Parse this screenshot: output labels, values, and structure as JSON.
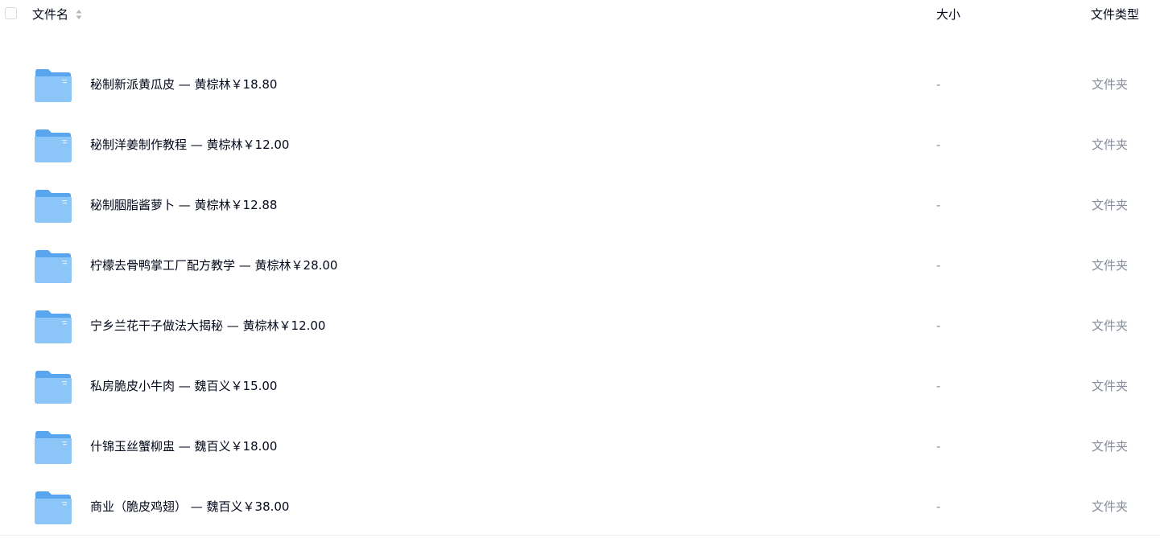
{
  "header": {
    "filename_label": "文件名",
    "size_label": "大小",
    "type_label": "文件类型"
  },
  "rows": [
    {
      "name": "秘制新派黄瓜皮 — 黄棕林￥18.80",
      "size": "-",
      "type": "文件夹"
    },
    {
      "name": "秘制洋姜制作教程 — 黄棕林￥12.00",
      "size": "-",
      "type": "文件夹"
    },
    {
      "name": "秘制胭脂酱萝卜 — 黄棕林￥12.88",
      "size": "-",
      "type": "文件夹"
    },
    {
      "name": "柠檬去骨鸭掌工厂配方教学 — 黄棕林￥28.00",
      "size": "-",
      "type": "文件夹"
    },
    {
      "name": "宁乡兰花干子做法大揭秘 — 黄棕林￥12.00",
      "size": "-",
      "type": "文件夹"
    },
    {
      "name": "私房脆皮小牛肉 — 魏百义￥15.00",
      "size": "-",
      "type": "文件夹"
    },
    {
      "name": "什锦玉丝蟹柳盅 — 魏百义￥18.00",
      "size": "-",
      "type": "文件夹"
    },
    {
      "name": "商业（脆皮鸡翅） — 魏百义￥38.00",
      "size": "-",
      "type": "文件夹"
    }
  ],
  "icons": {
    "folder": "folder-icon",
    "sort": "sort-icon"
  },
  "colors": {
    "folder_blue": "#6fb3f2",
    "text_primary": "#03081a",
    "text_secondary": "#878c9c"
  }
}
